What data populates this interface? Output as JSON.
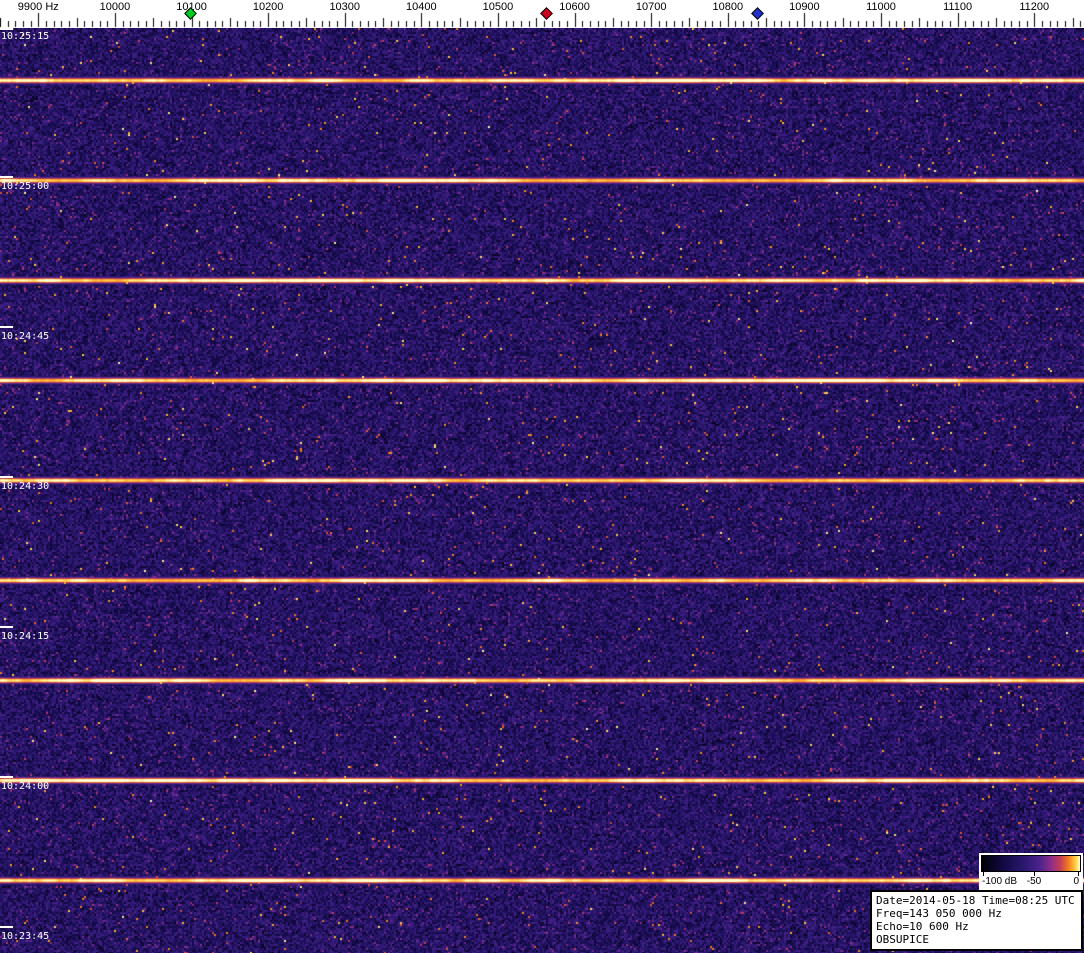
{
  "app": {
    "name": "radio meteor echo waterfall spectrogram display"
  },
  "colors": {
    "ruler_bg": "#ffffff",
    "tick": "#000000",
    "time_label": "#ffffff",
    "colormap_stops": [
      {
        "t": 0.0,
        "c": "#000006"
      },
      {
        "t": 0.22,
        "c": "#120944"
      },
      {
        "t": 0.42,
        "c": "#2a176e"
      },
      {
        "t": 0.58,
        "c": "#47228a"
      },
      {
        "t": 0.7,
        "c": "#8a2d8a"
      },
      {
        "t": 0.8,
        "c": "#c63d52"
      },
      {
        "t": 0.88,
        "c": "#ef7b1e"
      },
      {
        "t": 0.95,
        "c": "#ffc93e"
      },
      {
        "t": 1.0,
        "c": "#ffffd0"
      }
    ]
  },
  "chart_data": {
    "type": "heatmap",
    "subtype": "radio-meteor-waterfall-spectrogram",
    "title": "",
    "x_axis": {
      "label": "Hz",
      "range": [
        9850,
        11265
      ],
      "major_tick_step": 100,
      "medium_tick_step": 50,
      "minor_tick_step": 10,
      "first_labeled_tick_hz": 9900,
      "tick_labels": [
        "9900 Hz",
        "10000",
        "10100",
        "10200",
        "10300",
        "10400",
        "10500",
        "10600",
        "10700",
        "10800",
        "10900",
        "11000",
        "11100",
        "11200"
      ]
    },
    "y_axis": {
      "label": "UTC time",
      "direction": "latest-at-top",
      "top_time": "10:25:15",
      "bottom_time": "10:23:45",
      "tick_step_seconds": 15,
      "tick_labels": [
        "10:25:15",
        "10:25:00",
        "10:24:45",
        "10:24:30",
        "10:24:15",
        "10:24:00",
        "10:23:45"
      ],
      "pixels_per_second": 10
    },
    "intensity": {
      "unit": "dB",
      "min": -100,
      "max": 0
    },
    "background": "dark purple-indigo noise floor with magenta and rare orange speckles",
    "echo_pulses": {
      "description": "bright yellow-orange full-bandwidth horizontal echo lines, one every 10 seconds",
      "period_seconds": 10,
      "times": [
        "10:25:10",
        "10:25:00",
        "10:24:50",
        "10:24:40",
        "10:24:30",
        "10:24:20",
        "10:24:10",
        "10:24:00",
        "10:23:50"
      ]
    },
    "frequency_markers": [
      {
        "color": "green",
        "color_hex": "#00cc22",
        "hz": 10100
      },
      {
        "color": "red",
        "color_hex": "#cc0022",
        "hz": 10565
      },
      {
        "color": "blue",
        "color_hex": "#2233cc",
        "hz": 10840
      }
    ]
  },
  "legend": {
    "min_label": "-100 dB",
    "mid_label": "-50",
    "max_label": "0"
  },
  "info_box": {
    "date_time": "Date=2014-05-18 Time=08:25 UTC",
    "frequency": "Freq=143 050 000 Hz",
    "echo": "Echo=10 600 Hz",
    "station": "OBSUPICE"
  }
}
